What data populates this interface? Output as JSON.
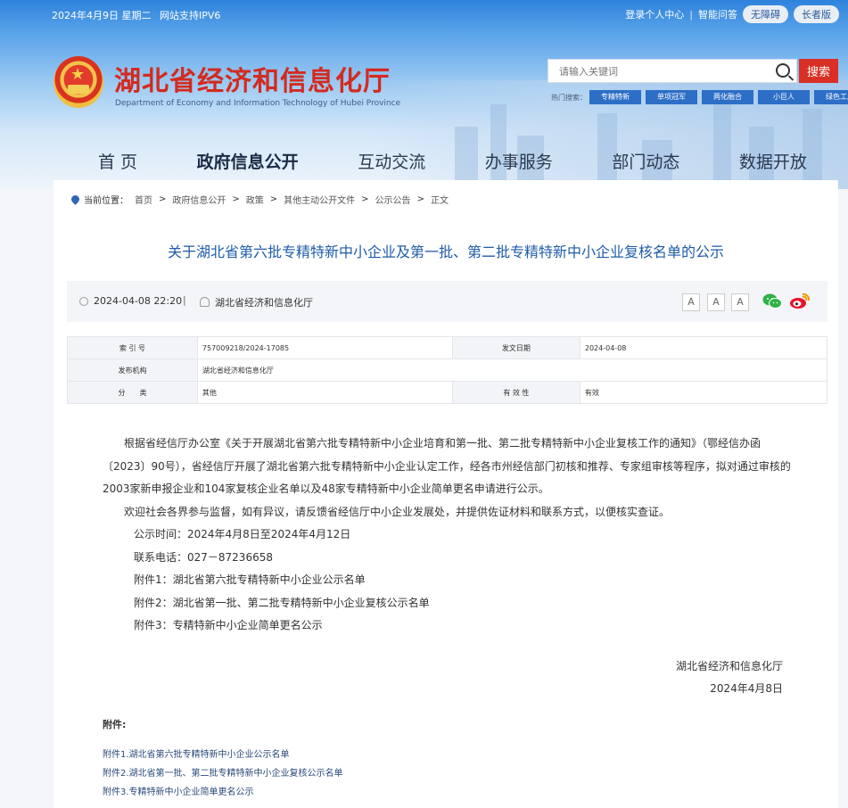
{
  "topbar": {
    "date": "2024年4月9日 星期二",
    "ipv6": "网站支持IPV6",
    "login": "登录个人中心",
    "sep": "|",
    "smart_qa": "智能问答",
    "accessible": "无障碍",
    "elderly": "长者版"
  },
  "brand": {
    "title": "湖北省经济和信息化厅",
    "subtitle": "Department of Economy and Information Technology of Hubei Province"
  },
  "search": {
    "placeholder": "请输入关键词",
    "button": "搜索",
    "hot_label": "热门搜索：",
    "hot_tags": [
      "专精特新",
      "单项冠军",
      "两化融合",
      "小巨人",
      "绿色工厂"
    ]
  },
  "nav": {
    "items": [
      "首 页",
      "政府信息公开",
      "互动交流",
      "办事服务",
      "部门动态",
      "数据开放"
    ],
    "active": "政府信息公开"
  },
  "breadcrumb": {
    "label": "当前位置：",
    "items": [
      "首页",
      "政府信息公开",
      "政策",
      "其他主动公开文件",
      "公示公告",
      "正文"
    ],
    "separator": ">"
  },
  "article": {
    "title": "关于湖北省第六批专精特新中小企业及第一批、第二批专精特新中小企业复核名单的公示",
    "date": "2024-04-08 22:20",
    "divider": "|",
    "source": "湖北省经济和信息化厅",
    "font_sizes": [
      "A",
      "A",
      "A"
    ]
  },
  "info_table": {
    "index_label": "索 引 号",
    "index_value": "757009218/2024-17085",
    "date_label": "发文日期",
    "date_value": "2024-04-08",
    "publisher_label": "发布机构",
    "publisher_value": "湖北省经济和信息化厅",
    "category_label": "分　　类",
    "category_value": "其他",
    "validity_label": "有 效 性",
    "validity_value": "有效"
  },
  "body": {
    "paragraph1": "根据省经信厅办公室《关于开展湖北省第六批专精特新中小企业培育和第一批、第二批专精特新中小企业复核工作的通知》（鄂经信办函〔2023〕90号），省经信厅开展了湖北省第六批专精特新中小企业认定工作，经各市州经信部门初核和推荐、专家组审核等程序，拟对通过审核的2003家新申报企业和104家复核企业名单以及48家专精特新中小企业简单更名申请进行公示。",
    "paragraph2": "欢迎社会各界参与监督，如有异议，请反馈省经信厅中小企业发展处，并提供佐证材料和联系方式，以便核实查证。",
    "period": "公示时间：2024年4月8日至2024年4月12日",
    "phone": "联系电话：027－87236658",
    "attachment1": "附件1：湖北省第六批专精特新中小企业公示名单",
    "attachment2": "附件2：湖北省第一批、第二批专精特新中小企业复核公示名单",
    "attachment3": "附件3：专精特新中小企业简单更名公示",
    "signature": "湖北省经济和信息化厅",
    "sign_date": "2024年4月8日"
  },
  "attachments": {
    "title": "附件:",
    "links": [
      "附件1.湖北省第六批专精特新中小企业公示名单",
      "附件2.湖北省第一批、第二批专精特新中小企业复核公示名单",
      "附件3.专精特新中小企业简单更名公示"
    ]
  },
  "colors": {
    "brand_red": "#d42a1f",
    "link_blue": "#1f5ca8",
    "tag_blue": "#2d6fc7"
  }
}
